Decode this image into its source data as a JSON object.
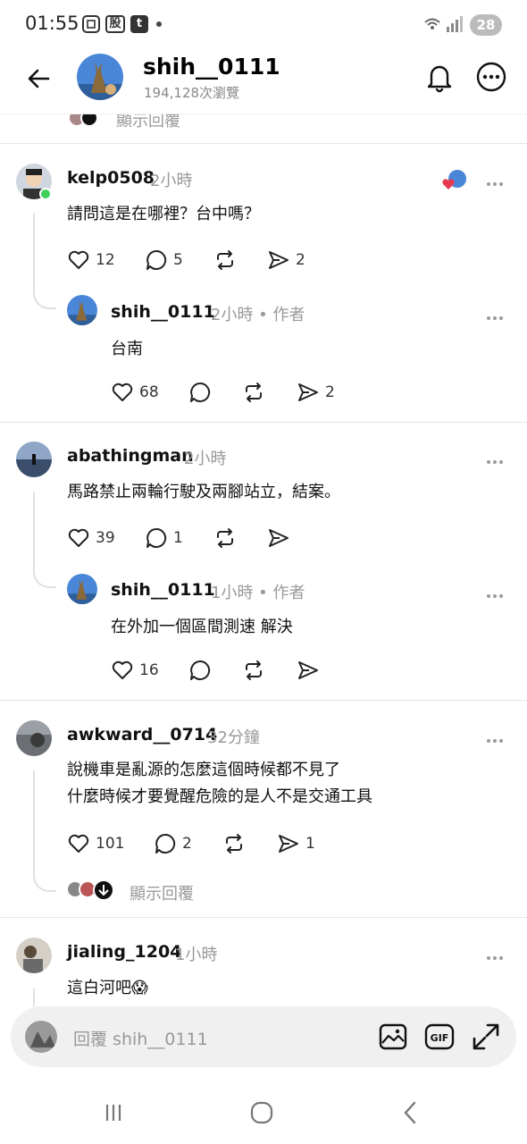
{
  "status_bar": {
    "time": "01:55",
    "icon1": "screenshot-icon",
    "icon2_text": "股",
    "icon3_text": "t",
    "battery": "28"
  },
  "header": {
    "username": "shih__0111",
    "views": "194,128次瀏覽"
  },
  "top_partial": {
    "show_replies": "顯示回覆"
  },
  "comments": [
    {
      "user": "kelp0508",
      "time": "2小時",
      "text": "請問這是在哪裡？台中嗎？",
      "likes": "12",
      "replies": "5",
      "reposts": "",
      "shares": "2",
      "reply": {
        "user": "shih__0111",
        "meta": "2小時 • 作者",
        "text": "台南",
        "likes": "68",
        "replies": "",
        "reposts": "",
        "shares": "2"
      }
    },
    {
      "user": "abathingman",
      "time": "2小時",
      "text": "馬路禁止兩輪行駛及兩腳站立，結案。",
      "likes": "39",
      "replies": "1",
      "reposts": "",
      "shares": "",
      "reply": {
        "user": "shih__0111",
        "meta": "1小時 • 作者",
        "text": "在外加一個區間測速 解決",
        "likes": "16",
        "replies": "",
        "reposts": "",
        "shares": ""
      }
    },
    {
      "user": "awkward__0714",
      "time": "32分鐘",
      "text_line1": "說機車是亂源的怎麼這個時候都不見了",
      "text_line2": "什麼時候才要覺醒危險的是人不是交通工具",
      "likes": "101",
      "replies": "2",
      "reposts": "",
      "shares": "1",
      "show_replies": "顯示回覆"
    },
    {
      "user": "jialing_1204",
      "time": "1小時",
      "text": "這白河吧😱"
    }
  ],
  "reply_bar": {
    "placeholder": "回覆 shih__0111"
  },
  "colors": {
    "like_red": "#e8384f",
    "online_green": "#3ecf5c",
    "muted": "#999999"
  }
}
